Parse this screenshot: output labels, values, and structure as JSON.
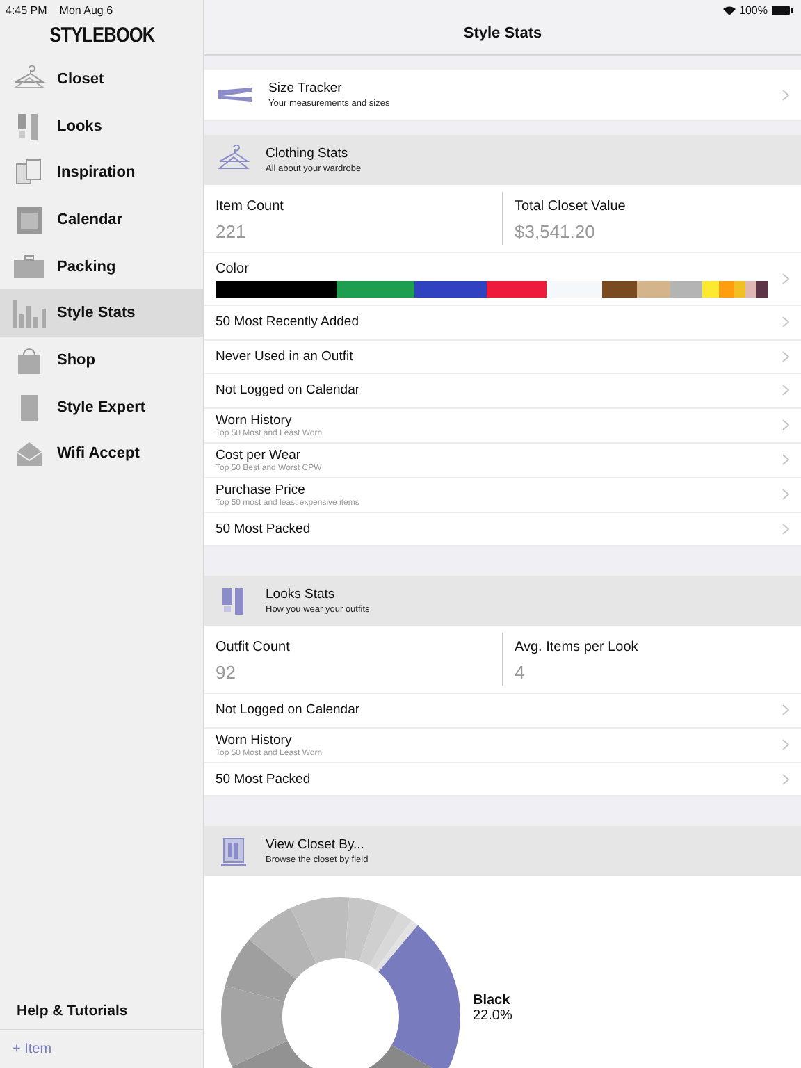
{
  "status_bar": {
    "time": "4:45 PM",
    "date": "Mon Aug 6",
    "battery": "100%"
  },
  "sidebar": {
    "logo": "STYLEBOOK",
    "items": [
      {
        "label": "Closet",
        "selected": false
      },
      {
        "label": "Looks",
        "selected": false
      },
      {
        "label": "Inspiration",
        "selected": false
      },
      {
        "label": "Calendar",
        "selected": false
      },
      {
        "label": "Packing",
        "selected": false
      },
      {
        "label": "Style Stats",
        "selected": true
      },
      {
        "label": "Shop",
        "selected": false
      },
      {
        "label": "Style Expert",
        "selected": false
      },
      {
        "label": "Wifi Accept",
        "selected": false
      }
    ],
    "help": "Help & Tutorials",
    "add_item": "+ Item"
  },
  "header": {
    "title": "Style Stats"
  },
  "size_tracker": {
    "title": "Size Tracker",
    "subtitle": "Your measurements and sizes"
  },
  "clothing_stats": {
    "title": "Clothing Stats",
    "subtitle": "All about your wardrobe",
    "stats": [
      {
        "label": "Item Count",
        "value": "221"
      },
      {
        "label": "Total Closet Value",
        "value": "$3,541.20"
      }
    ],
    "color": {
      "label": "Color",
      "segments": [
        {
          "color": "#000000"
        },
        {
          "color": "#1e9e50"
        },
        {
          "color": "#2f43c0"
        },
        {
          "color": "#ee1b3a"
        },
        {
          "color": "#f5f8fa"
        },
        {
          "color": "#7a4a20"
        },
        {
          "color": "#d4b48a"
        },
        {
          "color": "#b4b4b4"
        },
        {
          "color": "#fde92f"
        },
        {
          "color": "#ff9f0f"
        },
        {
          "color": "#f3c024"
        },
        {
          "color": "#dfb8b6"
        },
        {
          "color": "#5e3548"
        }
      ]
    },
    "rows": [
      {
        "title": "50 Most Recently Added"
      },
      {
        "title": "Never Used in an Outfit"
      },
      {
        "title": "Not Logged on Calendar"
      },
      {
        "title": "Worn History",
        "subtitle": "Top 50 Most and Least Worn"
      },
      {
        "title": "Cost per Wear",
        "subtitle": "Top 50 Best and Worst CPW"
      },
      {
        "title": "Purchase Price",
        "subtitle": "Top 50 most and least expensive items"
      },
      {
        "title": "50 Most Packed"
      }
    ]
  },
  "looks_stats": {
    "title": "Looks Stats",
    "subtitle": "How you wear your outfits",
    "stats": [
      {
        "label": "Outfit Count",
        "value": "92"
      },
      {
        "label": "Avg. Items per Look",
        "value": "4"
      }
    ],
    "rows": [
      {
        "title": "Not Logged on Calendar"
      },
      {
        "title": "Worn History",
        "subtitle": "Top 50 Most and Least Worn"
      },
      {
        "title": "50 Most Packed"
      }
    ]
  },
  "view_closet": {
    "title": "View Closet By...",
    "subtitle": "Browse the closet by field",
    "highlight": {
      "label": "Black",
      "percent": "22.0%"
    }
  }
}
